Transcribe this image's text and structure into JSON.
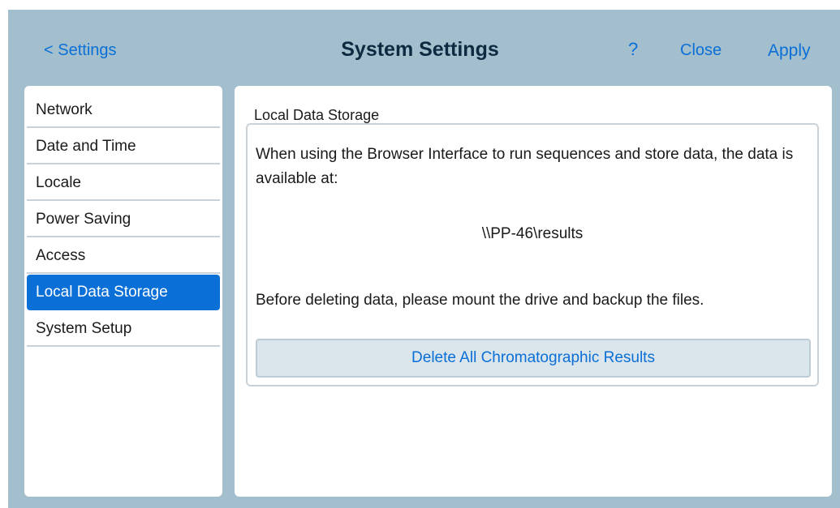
{
  "header": {
    "back_label": "< Settings",
    "title": "System Settings",
    "help_label": "?",
    "close_label": "Close",
    "apply_label": "Apply"
  },
  "sidebar": {
    "items": [
      {
        "label": "Network",
        "active": false
      },
      {
        "label": "Date and Time",
        "active": false
      },
      {
        "label": "Locale",
        "active": false
      },
      {
        "label": "Power Saving",
        "active": false
      },
      {
        "label": "Access",
        "active": false
      },
      {
        "label": "Local Data Storage",
        "active": true
      },
      {
        "label": "System Setup",
        "active": false
      }
    ]
  },
  "main": {
    "section_title": "Local Data Storage",
    "description": "When using the Browser Interface to run sequences and store data, the data is available at:",
    "path": "\\\\PP-46\\results",
    "note": "Before deleting data, please mount the drive and backup the files.",
    "delete_button_label": "Delete All Chromatographic Results"
  },
  "colors": {
    "frame_background": "#a3bfce",
    "accent": "#0a6fd6",
    "title_text": "#0c2a40"
  }
}
